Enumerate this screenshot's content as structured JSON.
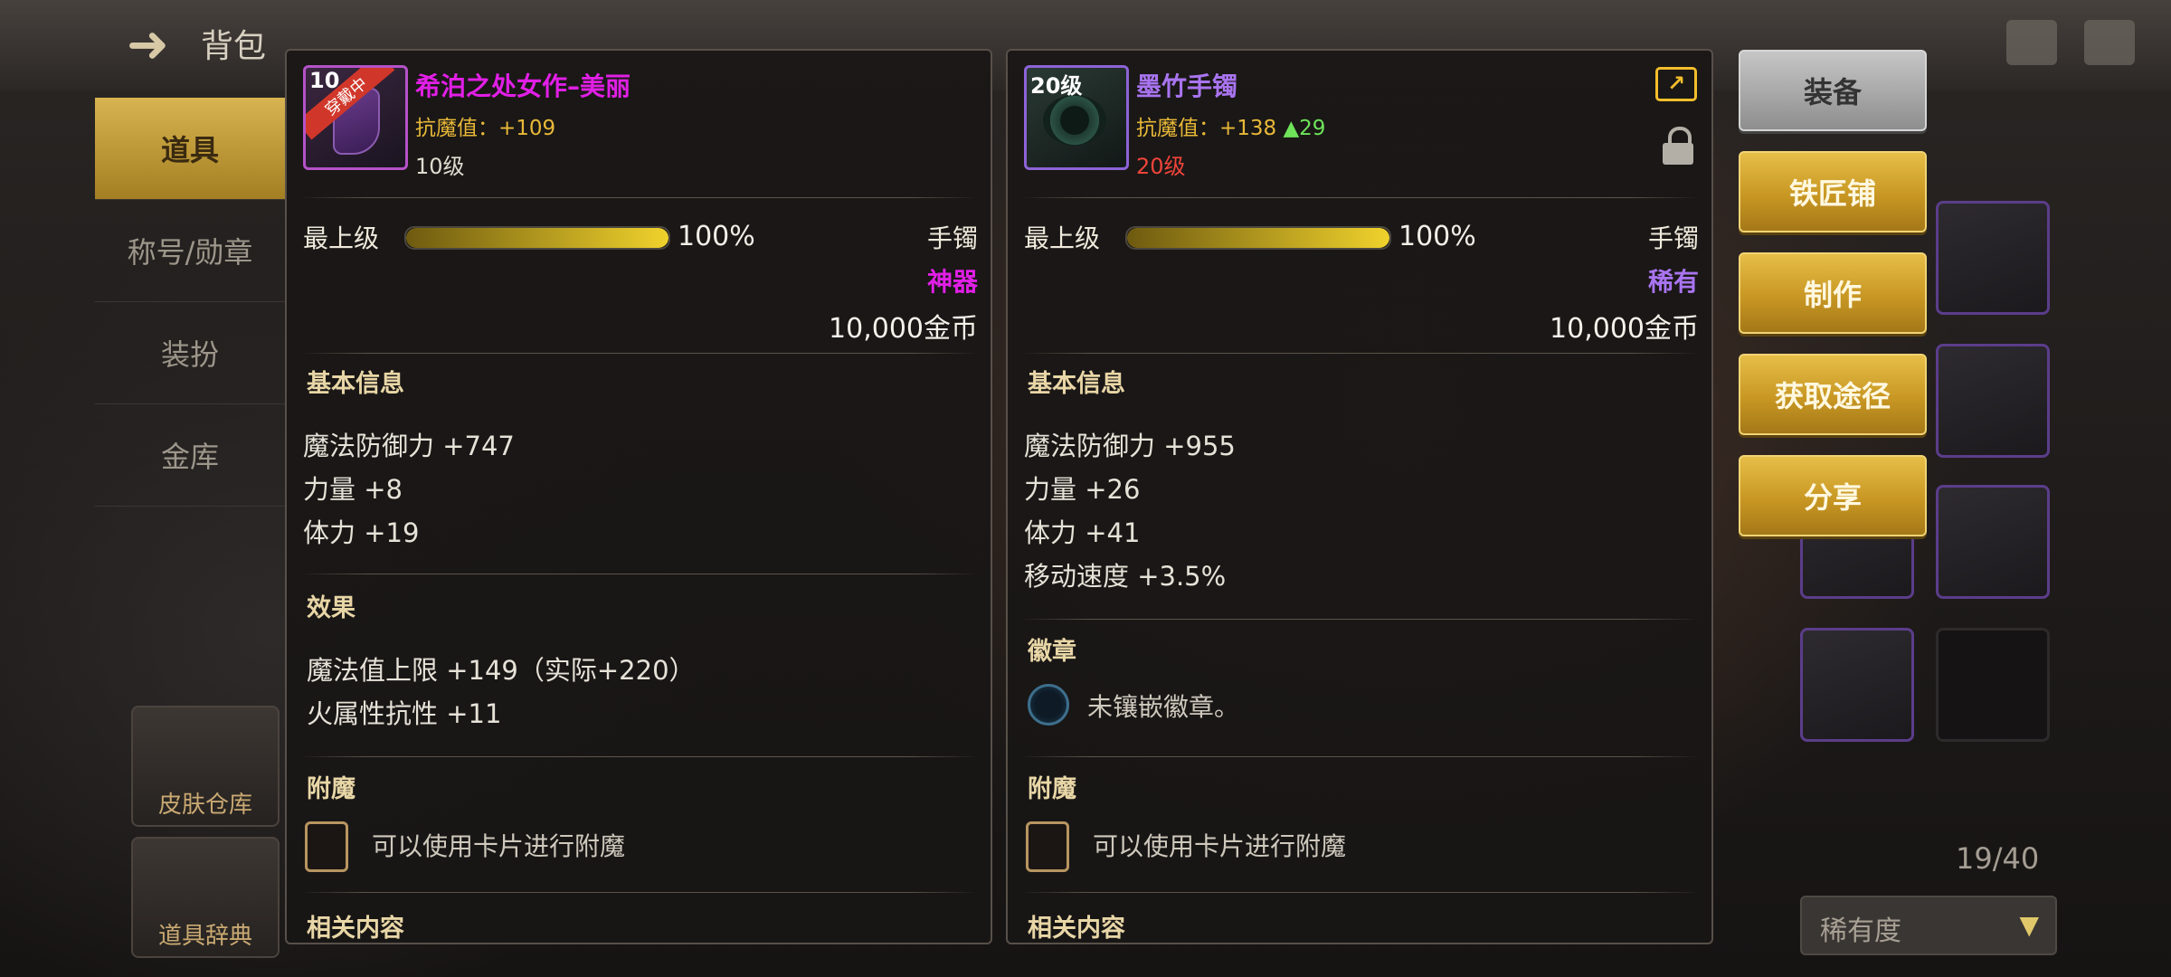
{
  "background": {
    "title": "背包",
    "sidebar_items": [
      "道具",
      "称号/勋章",
      "装扮",
      "金库"
    ],
    "tile_labels": [
      "皮肤仓库",
      "道具辞典"
    ],
    "inventory_count": "19/40",
    "sort_label": "稀有度"
  },
  "left_item": {
    "level_badge": "10",
    "equipped_ribbon": "穿戴中",
    "name": "希泊之处女作–美丽",
    "anti_magic_label": "抗魔值：+109",
    "level": "10级",
    "max_label": "最上级",
    "progress": 1.0,
    "progress_text": "100%",
    "slot": "手镯",
    "grade": "神器",
    "price": "10,000金币",
    "basic_title": "基本信息",
    "basic_stats": [
      "魔法防御力 +747",
      "力量 +8",
      "体力 +19"
    ],
    "effect_title": "效果",
    "effects": [
      "魔法值上限 +149（实际+220）",
      "火属性抗性 +11"
    ],
    "enchant_title": "附魔",
    "enchant_text": "可以使用卡片进行附魔",
    "related_title": "相关内容"
  },
  "right_item": {
    "level_badge": "20级",
    "name": "墨竹手镯",
    "anti_magic_label": "抗魔值：+138",
    "anti_magic_up": "▲29",
    "level": "20级",
    "max_label": "最上级",
    "progress": 1.0,
    "progress_text": "100%",
    "slot": "手镯",
    "grade": "稀有",
    "price": "10,000金币",
    "basic_title": "基本信息",
    "basic_stats": [
      "魔法防御力 +955",
      "力量 +26",
      "体力 +41",
      "移动速度 +3.5%"
    ],
    "badge_title": "徽章",
    "badge_text": "未镶嵌徽章。",
    "enchant_title": "附魔",
    "enchant_text": "可以使用卡片进行附魔",
    "related_title": "相关内容"
  },
  "actions": {
    "equip": "装备",
    "blacksmith": "铁匠铺",
    "craft": "制作",
    "obtain": "获取途径",
    "share": "分享"
  },
  "colors": {
    "legend": "#e11fe6",
    "rare": "#a974f0",
    "gold_button": "#c89723",
    "stat_gold": "#e8b838",
    "stat_up": "#6ee35a",
    "level_red": "#f0443a"
  }
}
